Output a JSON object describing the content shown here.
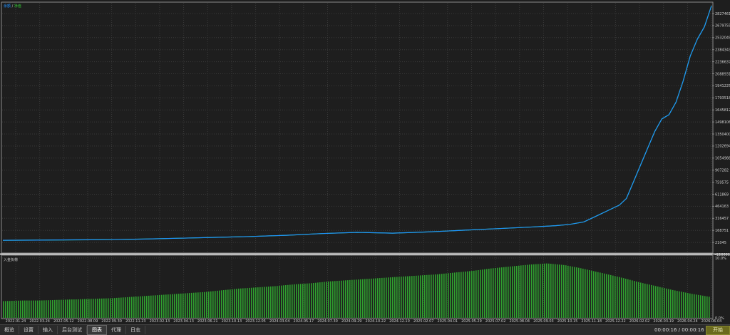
{
  "legend": {
    "balance": "余额",
    "separator": "/",
    "equity": "净值",
    "balance_color": "#1e90ff",
    "equity_color": "#32cd32"
  },
  "deposit_label": "入金负荷",
  "main_axis_labels": [
    "2827461",
    "2679755",
    "2532049",
    "2384343",
    "2236637",
    "2088931",
    "1941225",
    "1793518",
    "1645812",
    "1498106",
    "1350400",
    "1202694",
    "1054988",
    "907282",
    "759575",
    "611869",
    "464163",
    "316457",
    "168751",
    "21045",
    "-126661"
  ],
  "lower_axis_labels": [
    "10.0%",
    "0.0%"
  ],
  "date_labels": [
    "2022.01.24",
    "2022.03.24",
    "2022.05.12",
    "2022.08.09",
    "2022.09.30",
    "2022.11.23",
    "2023.02.13",
    "2023.04.13",
    "2023.06.21",
    "2023.10.13",
    "2023.12.05",
    "2024.03.04",
    "2024.05.17",
    "2024.07.30",
    "2024.09.29",
    "2024.10.22",
    "2024.12.10",
    "2025.02.07",
    "2025.04.01",
    "2025.05.29",
    "2025.07.02",
    "2025.08.04",
    "2025.09.03",
    "2025.10.15",
    "2025.11.18",
    "2025.12.22",
    "2026.02.02",
    "2026.03.19",
    "2026.04.24",
    "2026.06.04"
  ],
  "tabs": [
    "概览",
    "设置",
    "输入",
    "后台测试",
    "图表",
    "代理",
    "日志"
  ],
  "active_tab": "图表",
  "timer": "00:00:16 / 00:00:16",
  "start_button": "开始",
  "chart_data": {
    "type": "line",
    "title": "",
    "series": [
      {
        "name": "余额",
        "color": "#1e90ff"
      },
      {
        "name": "净值",
        "color": "#32cd32"
      }
    ],
    "x": [
      0,
      0.05,
      0.1,
      0.15,
      0.2,
      0.25,
      0.3,
      0.35,
      0.4,
      0.45,
      0.5,
      0.55,
      0.6,
      0.65,
      0.7,
      0.75,
      0.78,
      0.8,
      0.82,
      0.84,
      0.86,
      0.87,
      0.88,
      0.885,
      0.89,
      0.9,
      0.91,
      0.92,
      0.93,
      0.94,
      0.95,
      0.96,
      0.97,
      0.98,
      0.99,
      1.0
    ],
    "values": [
      0,
      2000,
      5000,
      8000,
      15000,
      25000,
      35000,
      45000,
      60000,
      80000,
      95000,
      85000,
      100000,
      120000,
      140000,
      160000,
      175000,
      190000,
      220000,
      300000,
      380000,
      420000,
      500000,
      600000,
      700000,
      900000,
      1100000,
      1300000,
      1450000,
      1500000,
      1650000,
      1900000,
      2200000,
      2400000,
      2550000,
      2800000
    ],
    "ylim": [
      -126661,
      2827461
    ],
    "grid": true,
    "legend_position": "top-left",
    "deposit_load": {
      "type": "bar",
      "ylim": [
        0,
        10
      ],
      "unit": "%",
      "levels": [
        2.8,
        2.9,
        2.9,
        3.0,
        3.1,
        3.2,
        3.3,
        3.5,
        3.7,
        3.9,
        4.1,
        4.3,
        4.6,
        4.9,
        5.1,
        5.3,
        5.6,
        5.8,
        6.1,
        6.3,
        6.5,
        6.7,
        6.9,
        7.1,
        7.3,
        7.6,
        7.9,
        8.3,
        8.6,
        8.9,
        9.1,
        8.8,
        8.2,
        7.5,
        6.8,
        6.0,
        5.3,
        4.6,
        4.0,
        3.5
      ]
    }
  }
}
